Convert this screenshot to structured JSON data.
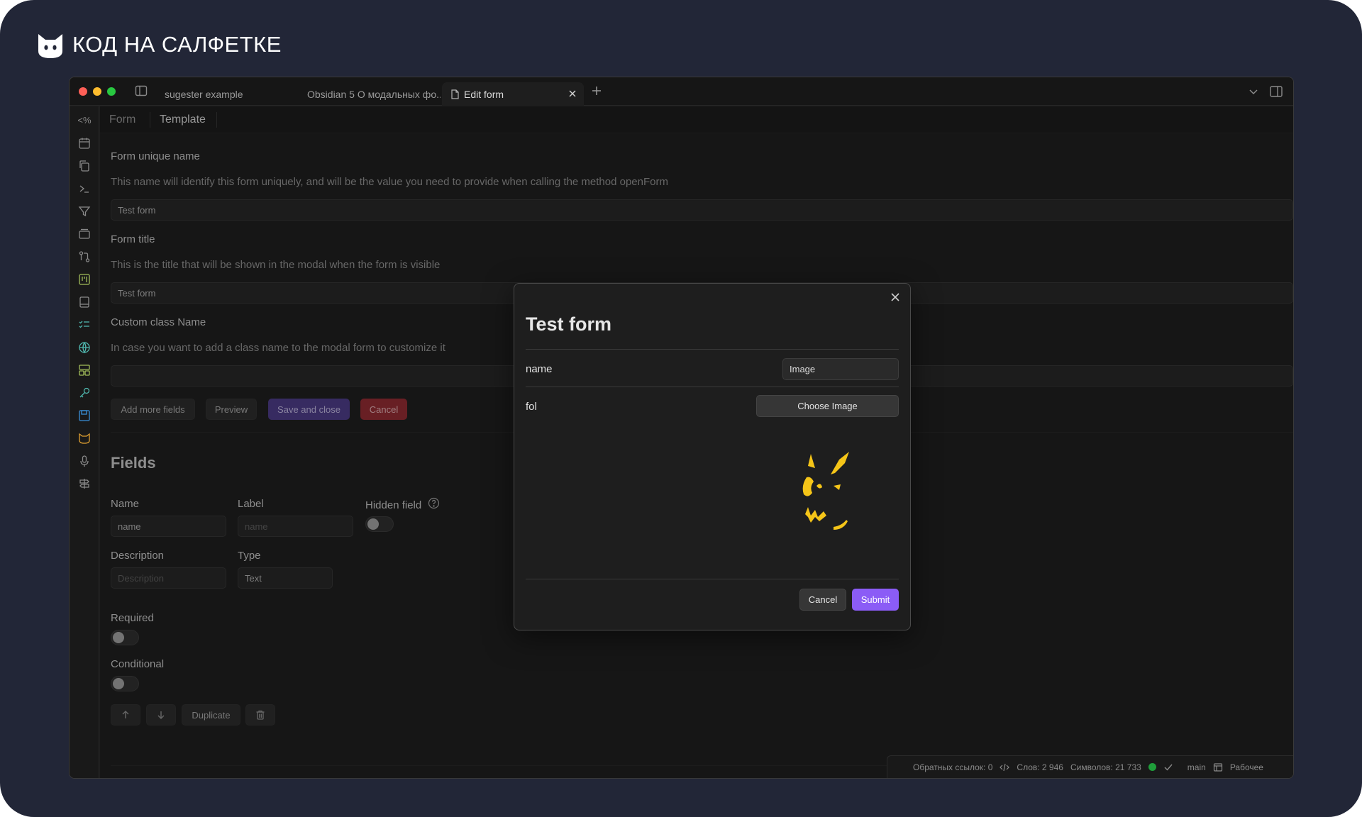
{
  "brand": {
    "text": "КОД НА САЛФЕТКЕ",
    "icon": "cat-icon"
  },
  "tabs": [
    {
      "label": "sugester example",
      "active": false
    },
    {
      "label": "Obsidian 5 О модальных фо...",
      "active": false
    },
    {
      "label": "Edit form",
      "active": true
    }
  ],
  "view_tabs": {
    "form": "Form",
    "template": "Template"
  },
  "editor": {
    "unique_name": {
      "label": "Form unique name",
      "description": "This name will identify this form uniquely, and will be the value you need to provide when calling the method openForm",
      "value": "Test form"
    },
    "title": {
      "label": "Form title",
      "description": "This is the title that will be shown in the modal when the form is visible",
      "value": "Test form"
    },
    "class_name": {
      "label": "Custom class Name",
      "description": "In case you want to add a class name to the modal form to customize it",
      "value": ""
    },
    "buttons": {
      "add_more": "Add more fields",
      "preview": "Preview",
      "save_close": "Save and close",
      "cancel": "Cancel"
    },
    "fields_heading": "Fields",
    "field": {
      "name_label": "Name",
      "name_value": "name",
      "label_label": "Label",
      "label_placeholder": "name",
      "hidden_label": "Hidden field",
      "description_label": "Description",
      "description_placeholder": "Description",
      "type_label": "Type",
      "type_value": "Text",
      "required_label": "Required",
      "conditional_label": "Conditional",
      "duplicate": "Duplicate"
    }
  },
  "modal": {
    "title": "Test form",
    "row1_label": "name",
    "row1_value": "Image",
    "row2_label": "fol",
    "choose_button": "Choose Image",
    "cancel": "Cancel",
    "submit": "Submit"
  },
  "status": {
    "backlinks": "Обратных ссылок: 0",
    "words": "Слов: 2 946",
    "chars": "Символов: 21 733",
    "branch": "main",
    "workspace": "Рабочее"
  },
  "colors": {
    "accent": "#8b5cf6",
    "danger": "#8b2a31",
    "frame": "#222637",
    "image": "#f5c518"
  }
}
